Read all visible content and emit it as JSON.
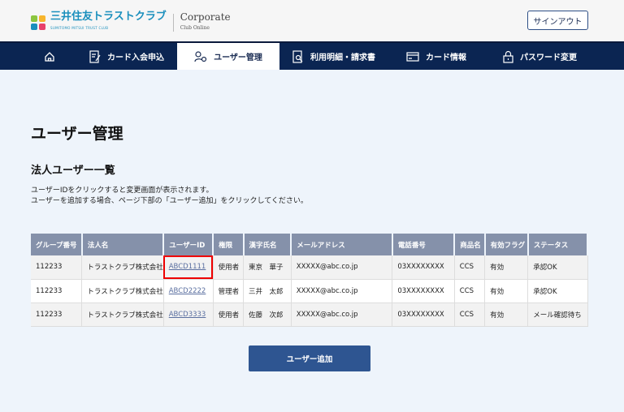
{
  "header": {
    "logo_text": "三井住友トラストクラブ",
    "logo_sub": "SUMITOMO MITSUI TRUST CLUB",
    "corporate": "Corporate",
    "club_online": "Club Online",
    "signout": "サインアウト"
  },
  "nav": {
    "items": [
      {
        "label": "",
        "icon": "home-icon"
      },
      {
        "label": "カード入会申込",
        "icon": "form-edit-icon"
      },
      {
        "label": "ユーザー管理",
        "icon": "user-gear-icon",
        "active": true
      },
      {
        "label": "利用明細・請求書",
        "icon": "document-search-icon"
      },
      {
        "label": "カード情報",
        "icon": "card-icon"
      },
      {
        "label": "パスワード変更",
        "icon": "lock-icon"
      }
    ]
  },
  "page": {
    "title": "ユーザー管理",
    "subtitle": "法人ユーザー一覧",
    "desc1": "ユーザーIDをクリックすると変更画面が表示されます。",
    "desc2": "ユーザーを追加する場合、ページ下部の「ユーザー追加」をクリックしてください。"
  },
  "table": {
    "headers": [
      "グループ番号",
      "法人名",
      "ユーザーID",
      "権限",
      "漢字氏名",
      "メールアドレス",
      "電話番号",
      "商品名",
      "有効フラグ",
      "ステータス"
    ],
    "rows": [
      [
        "112233",
        "トラストクラブ株式会社",
        "ABCD1111",
        "使用者",
        "東京　華子",
        "XXXXX@abc.co.jp",
        "03XXXXXXXX",
        "CCS",
        "有効",
        "承認OK"
      ],
      [
        "112233",
        "トラストクラブ株式会社",
        "ABCD2222",
        "管理者",
        "三井　太郎",
        "XXXXX@abc.co.jp",
        "03XXXXXXXX",
        "CCS",
        "有効",
        "承認OK"
      ],
      [
        "112233",
        "トラストクラブ株式会社",
        "ABCD3333",
        "使用者",
        "佐藤　次郎",
        "XXXXX@abc.co.jp",
        "03XXXXXXXX",
        "CCS",
        "有効",
        "メール確認待ち"
      ]
    ]
  },
  "add_button": "ユーザー追加",
  "colors": {
    "nav": "#0b2552",
    "table_header": "#8591aa",
    "button": "#2e5591",
    "highlight": "#e00000"
  }
}
